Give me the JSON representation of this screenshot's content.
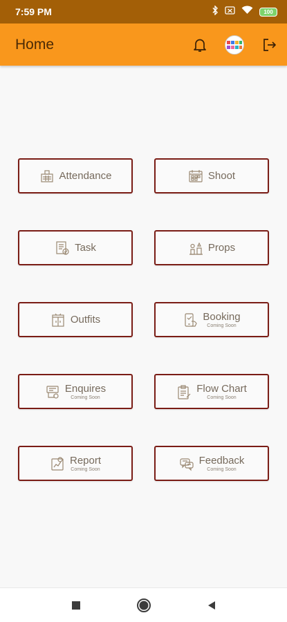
{
  "status_bar": {
    "time": "7:59 PM",
    "battery": "100",
    "icons": [
      "bluetooth-icon",
      "battery-saver-icon",
      "wifi-icon",
      "battery-icon"
    ]
  },
  "app_bar": {
    "title": "Home",
    "actions": [
      "notification-bell-icon",
      "profile-avatar",
      "logout-icon"
    ]
  },
  "menu": [
    {
      "id": "attendance",
      "label": "Attendance",
      "sub": "",
      "icon": "attendance-icon"
    },
    {
      "id": "shoot",
      "label": "Shoot",
      "sub": "",
      "icon": "shoot-calendar-icon"
    },
    {
      "id": "task",
      "label": "Task",
      "sub": "",
      "icon": "task-list-icon"
    },
    {
      "id": "props",
      "label": "Props",
      "sub": "",
      "icon": "props-icon"
    },
    {
      "id": "outfits",
      "label": "Outfits",
      "sub": "",
      "icon": "outfits-wardrobe-icon"
    },
    {
      "id": "booking",
      "label": "Booking",
      "sub": "Coming Soon",
      "icon": "booking-phone-icon"
    },
    {
      "id": "enquires",
      "label": "Enquires",
      "sub": "Coming Soon",
      "icon": "enquires-icon"
    },
    {
      "id": "flow-chart",
      "label": "Flow Chart",
      "sub": "Coming Soon",
      "icon": "flow-chart-clipboard-icon"
    },
    {
      "id": "report",
      "label": "Report",
      "sub": "Coming Soon",
      "icon": "report-chart-icon"
    },
    {
      "id": "feedback",
      "label": "Feedback",
      "sub": "Coming Soon",
      "icon": "feedback-chat-icon"
    }
  ],
  "nav_bar": [
    "recents-square-icon",
    "home-circle-icon",
    "back-triangle-icon"
  ],
  "colors": {
    "status_bar": "#a35f07",
    "app_bar": "#f9971c",
    "tile_border": "#7a1c15",
    "tile_text": "#766a5c",
    "background": "#f8f8f8"
  }
}
